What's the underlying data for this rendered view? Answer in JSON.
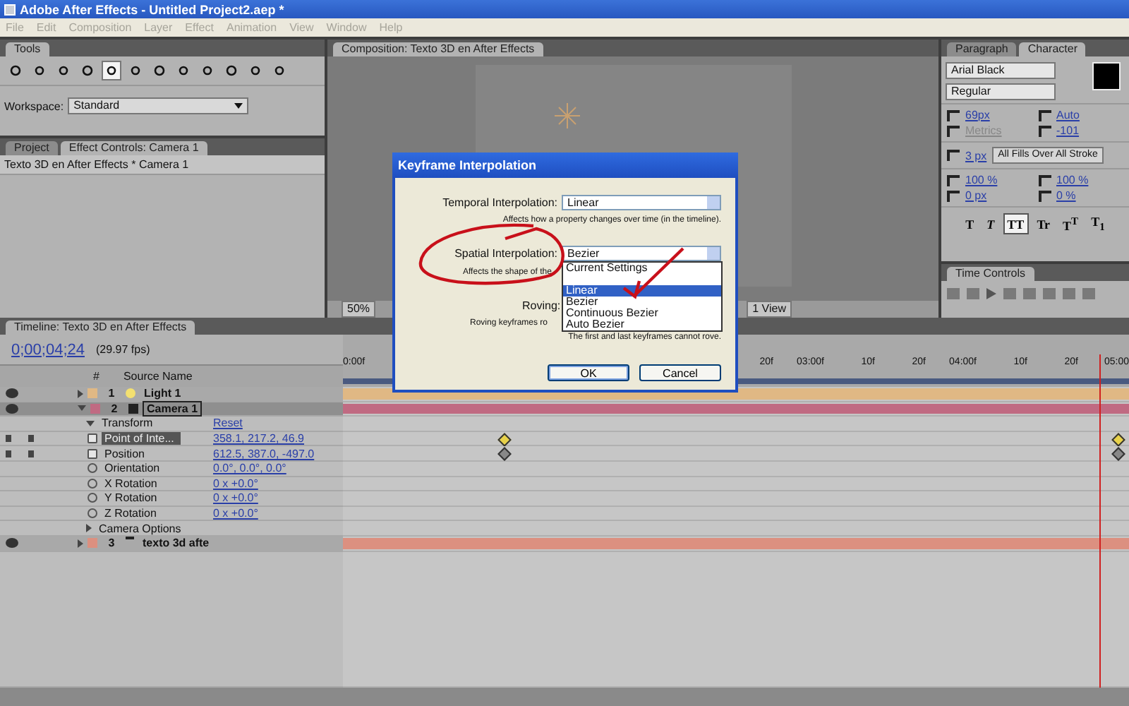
{
  "window": {
    "title": "Adobe After Effects - Untitled Project2.aep *"
  },
  "menu": [
    "File",
    "Edit",
    "Composition",
    "Layer",
    "Effect",
    "Animation",
    "View",
    "Window",
    "Help"
  ],
  "tools_panel": {
    "tab": "Tools",
    "tools": [
      {
        "selected": false
      },
      {
        "selected": false
      },
      {
        "selected": false
      },
      {
        "selected": false
      },
      {
        "selected": true
      },
      {
        "selected": false
      },
      {
        "selected": false
      },
      {
        "selected": false
      },
      {
        "selected": false
      },
      {
        "selected": false
      },
      {
        "selected": false
      },
      {
        "selected": false
      }
    ],
    "workspace_label": "Workspace:",
    "workspace": "Standard"
  },
  "project_panel": {
    "tabs": [
      {
        "label": "Project",
        "selected": false
      },
      {
        "label": "Effect Controls: Camera 1",
        "selected": true
      }
    ],
    "breadcrumb": "Texto 3D en After Effects * Camera 1"
  },
  "composition_panel": {
    "tab": "Composition: Texto 3D en After Effects",
    "zoom": "50%",
    "view": "1 View"
  },
  "character_panel": {
    "tabs": [
      {
        "label": "Paragraph",
        "selected": false
      },
      {
        "label": "Character",
        "selected": true
      }
    ],
    "font": "Arial Black",
    "style": "Regular",
    "metrics": [
      {
        "value": "69",
        "unit": "px",
        "disabled": false
      },
      {
        "value": "Auto",
        "disabled": false
      },
      {
        "value": "Metrics",
        "disabled": true
      },
      {
        "value": "-101",
        "disabled": false
      }
    ],
    "stroke_width": {
      "value": "3",
      "unit": "px"
    },
    "stroke_mode": "All Fills Over All Stroke",
    "scales": [
      {
        "value": "100",
        "unit": "%"
      },
      {
        "value": "100",
        "unit": "%"
      },
      {
        "value": "0",
        "unit": "px"
      },
      {
        "value": "0",
        "unit": "%"
      }
    ],
    "styles": [
      {
        "label": "T",
        "kind": "bold",
        "selected": false
      },
      {
        "label": "T",
        "kind": "italic",
        "selected": false
      },
      {
        "label": "TT",
        "kind": "caps",
        "selected": true
      },
      {
        "label": "Tr",
        "kind": "smallcaps",
        "selected": false
      },
      {
        "label": "T$^{T}$",
        "kind": "super",
        "selected": false
      },
      {
        "label": "T$_{1}$",
        "kind": "sub",
        "selected": false
      }
    ]
  },
  "time_controls": {
    "tab": "Time Controls"
  },
  "timeline": {
    "tab": "Timeline: Texto 3D en After Effects",
    "timecode": "0;00;04;24",
    "fps": "(29.97 fps)",
    "number_header": "#",
    "name_header": "Source Name",
    "ruler": [
      "0:00f",
      "20f",
      "03:00f",
      "10f",
      "20f",
      "04:00f",
      "10f",
      "20f",
      "05:00"
    ],
    "playhead": {
      "level": 0.963
    },
    "rows": [
      {
        "kind": "layer",
        "number": "1",
        "name": "Light 1",
        "color": "#e0b884",
        "expanded": false,
        "selected": false,
        "visible": true
      },
      {
        "kind": "layer",
        "number": "2",
        "name": "Camera 1",
        "color": "#c06a82",
        "expanded": true,
        "selected": true,
        "visible": true,
        "children": [
          {
            "kind": "group",
            "name": "Transform",
            "value": "Reset",
            "expanded": true,
            "children": [
              {
                "kind": "property",
                "name": "Point of Inte...",
                "value": "358.1, 217.2, 46.9",
                "animated": true,
                "selected": true
              },
              {
                "kind": "property",
                "name": "Position",
                "value": "612.5, 387.0, -497.0",
                "animated": true,
                "selected": false
              },
              {
                "kind": "property",
                "name": "Orientation",
                "value": "0.0°, 0.0°, 0.0°",
                "animated": false,
                "selected": false
              },
              {
                "kind": "property",
                "name": "X Rotation",
                "value": "0 x +0.0°",
                "animated": false,
                "selected": false
              },
              {
                "kind": "property",
                "name": "Y Rotation",
                "value": "0 x +0.0°",
                "animated": false,
                "selected": false
              },
              {
                "kind": "property",
                "name": "Z Rotation",
                "value": "0 x +0.0°",
                "animated": false,
                "selected": false
              }
            ]
          },
          {
            "kind": "group",
            "name": "Camera Options",
            "expanded": false
          }
        ]
      },
      {
        "kind": "layer",
        "number": "3",
        "name": "texto 3d afte",
        "color": "#dc9080",
        "expanded": false,
        "selected": false,
        "visible": true
      }
    ]
  },
  "dialog": {
    "title": "Keyframe Interpolation",
    "temporal_label": "Temporal Interpolation:",
    "temporal_value": "Linear",
    "temporal_note": "Affects how a property changes over time (in the timeline).",
    "spatial_label": "Spatial Interpolation:",
    "spatial_value": "Bezier",
    "spatial_note": "Affects the shape of the",
    "spatial_options": [
      {
        "kind": "option",
        "label": "Current Settings",
        "selected": false
      },
      {
        "kind": "separator"
      },
      {
        "kind": "option",
        "label": "Linear",
        "selected": true
      },
      {
        "kind": "option",
        "label": "Bezier",
        "selected": false
      },
      {
        "kind": "option",
        "label": "Continuous Bezier",
        "selected": false
      },
      {
        "kind": "option",
        "label": "Auto Bezier",
        "selected": false
      }
    ],
    "roving_label": "Roving:",
    "roving_note": "Roving keyframes ro",
    "roving_note_2": "The first and last keyframes cannot rove.",
    "buttons": [
      {
        "label": "OK",
        "default": true
      },
      {
        "label": "Cancel",
        "default": false
      }
    ]
  }
}
